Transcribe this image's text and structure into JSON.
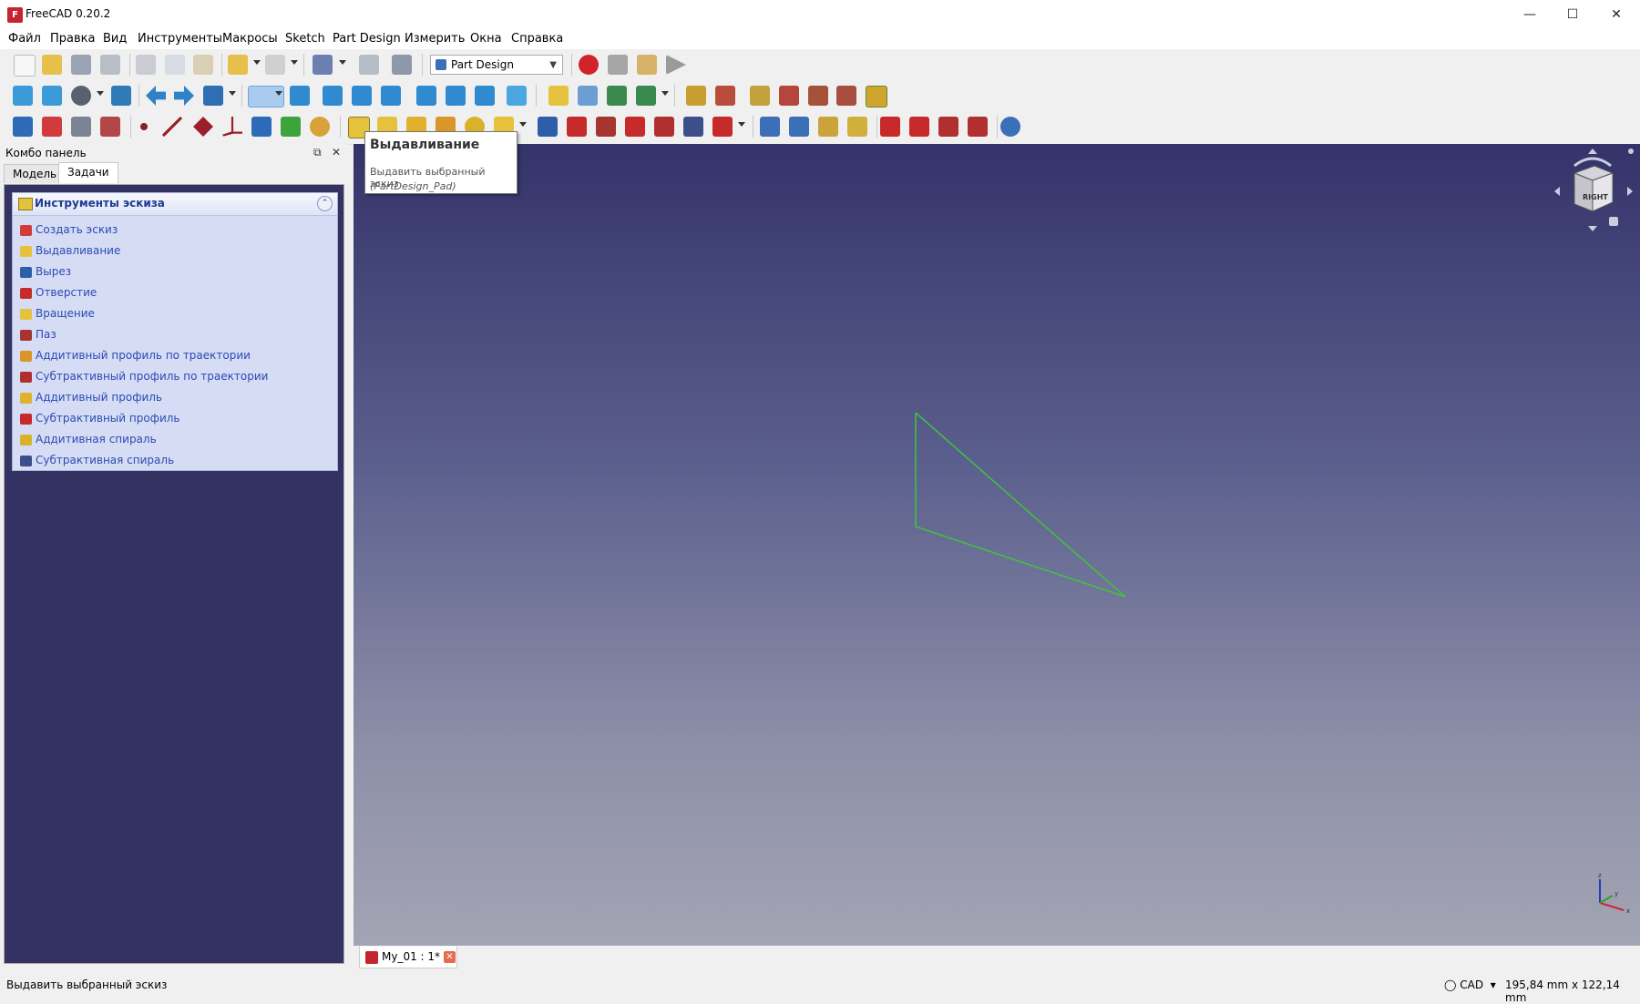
{
  "window": {
    "title": "FreeCAD 0.20.2"
  },
  "menu": [
    "Файл",
    "Правка",
    "Вид",
    "Инструменты",
    "Макросы",
    "Sketch",
    "Part Design",
    "Измерить",
    "Окна",
    "Справка"
  ],
  "workbench": {
    "selected": "Part Design"
  },
  "combo": {
    "title": "Комбо панель",
    "tabs": [
      "Модель",
      "Задачи"
    ]
  },
  "taskbox": {
    "title": "Инструменты эскиза",
    "items": [
      "Создать эскиз",
      "Выдавливание",
      "Вырез",
      "Отверстие",
      "Вращение",
      "Паз",
      "Аддитивный профиль по траектории",
      "Субтрактивный профиль по траектории",
      "Аддитивный профиль",
      "Субтрактивный профиль",
      "Аддитивная спираль",
      "Субтрактивная спираль"
    ]
  },
  "tooltip": {
    "title": "Выдавливание",
    "description": "Выдавить выбранный эскиз",
    "command": "(PartDesign_Pad)"
  },
  "document_tab": {
    "label": "My_01 : 1*"
  },
  "status": {
    "message": "Выдавить выбранный эскиз",
    "nav_style": "CAD",
    "dimensions": "195,84 mm x 122,14 mm"
  },
  "navcube": {
    "face": "RIGHT"
  },
  "axes": {
    "x": "x",
    "y": "y",
    "z": "z"
  },
  "colors": {
    "viewport_top": "#34336a",
    "viewport_bottom": "#a3a4b4",
    "sketch_line": "#3ec43e",
    "record": "#d2232a",
    "taskbox": "#d6dcf3",
    "panel": "#343163"
  }
}
